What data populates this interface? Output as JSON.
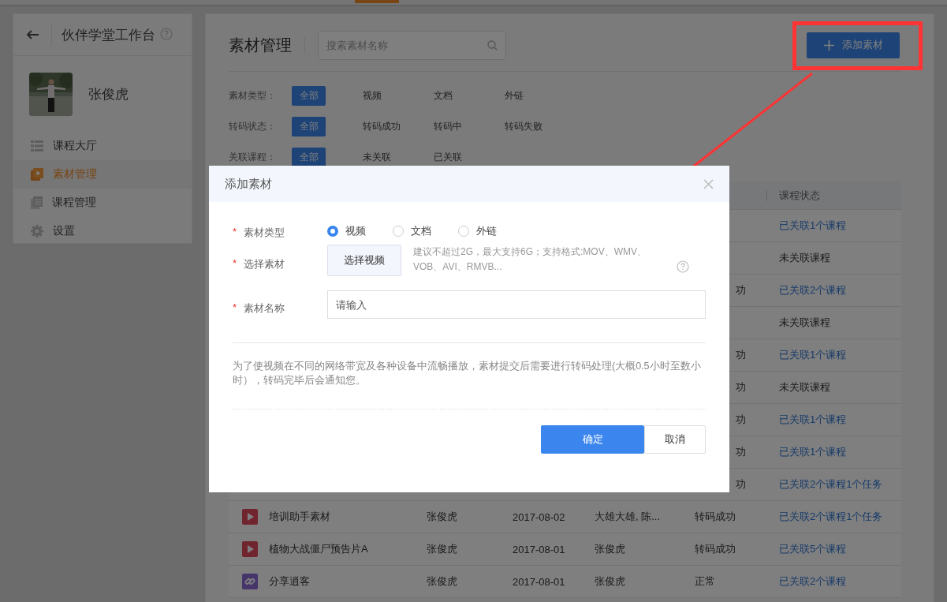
{
  "sidebar": {
    "title": "伙伴学堂工作台",
    "user": {
      "name": "张俊虎"
    },
    "menu": [
      {
        "label": "课程大厅",
        "kind": "list",
        "selected": false
      },
      {
        "label": "素材管理",
        "kind": "media",
        "selected": true
      },
      {
        "label": "课程管理",
        "kind": "doc",
        "selected": false
      },
      {
        "label": "设置",
        "kind": "gear",
        "selected": false
      }
    ]
  },
  "main": {
    "title": "素材管理",
    "search": {
      "placeholder": "搜索素材名称"
    },
    "add_button": "添加素材",
    "filters": [
      {
        "label": "素材类型：",
        "options": [
          {
            "label": "全部",
            "selected": true
          },
          {
            "label": "视频",
            "selected": false
          },
          {
            "label": "文档",
            "selected": false
          },
          {
            "label": "外链",
            "selected": false
          }
        ]
      },
      {
        "label": "转码状态：",
        "options": [
          {
            "label": "全部",
            "selected": true
          },
          {
            "label": "转码成功",
            "selected": false
          },
          {
            "label": "转码中",
            "selected": false
          },
          {
            "label": "转码失败",
            "selected": false
          }
        ]
      },
      {
        "label": "关联课程：",
        "options": [
          {
            "label": "全部",
            "selected": true
          },
          {
            "label": "未关联",
            "selected": false
          },
          {
            "label": "已关联",
            "selected": false
          }
        ]
      }
    ],
    "table": {
      "columns": [
        "课程状态"
      ],
      "rows": [
        {
          "kind": "covered",
          "course_status": "已关联1个课程",
          "linked": true
        },
        {
          "kind": "covered",
          "course_status": "未关联课程",
          "linked": false
        },
        {
          "kind": "covered",
          "transcode": "功",
          "course_status": "已关联2个课程",
          "linked": true
        },
        {
          "kind": "covered",
          "course_status": "未关联课程",
          "linked": false
        },
        {
          "kind": "covered",
          "transcode": "功",
          "course_status": "已关联1个课程",
          "linked": true
        },
        {
          "kind": "covered",
          "transcode": "功",
          "course_status": "未关联课程",
          "linked": false
        },
        {
          "kind": "covered",
          "transcode": "功",
          "course_status": "已关联1个课程",
          "linked": true
        },
        {
          "kind": "covered",
          "transcode": "功",
          "course_status": "已关联1个课程",
          "linked": true
        },
        {
          "kind": "covered",
          "transcode": "功",
          "course_status": "已关联2个课程1个任务",
          "linked": true
        },
        {
          "kind": "video",
          "name": "培训助手素材",
          "owner": "张俊虎",
          "date": "2017-08-02",
          "column_4": "大雄大雄, 陈...",
          "transcode": "转码成功",
          "course_status": "已关联2个课程1个任务",
          "linked": true
        },
        {
          "kind": "video",
          "name": "植物大战僵尸预告片A",
          "owner": "张俊虎",
          "date": "2017-08-01",
          "column_4": "张俊虎",
          "transcode": "转码成功",
          "course_status": "已关联5个课程",
          "linked": true
        },
        {
          "kind": "link",
          "name": "分享逍客",
          "owner": "张俊虎",
          "date": "2017-08-01",
          "column_4": "张俊虎",
          "transcode": "正常",
          "course_status": "已关联2个课程",
          "linked": true
        }
      ]
    }
  },
  "dialog": {
    "title": "添加素材",
    "fields": [
      {
        "kind": "radio",
        "label": "素材类型",
        "required_mark": "*",
        "options": [
          {
            "label": "视频",
            "selected": true
          },
          {
            "label": "文档",
            "selected": false
          },
          {
            "label": "外链",
            "selected": false
          }
        ]
      },
      {
        "kind": "file",
        "label": "选择素材",
        "required_mark": "*",
        "button": "选择视频",
        "hint": "建议不超过2G，最大支持6G；支持格式:MOV、WMV、VOB、AVI、RMVB..."
      },
      {
        "kind": "text",
        "label": "素材名称",
        "required_mark": "*",
        "placeholder": "请输入"
      }
    ],
    "note": "为了使视频在不同的网络带宽及各种设备中流畅播放，素材提交后需要进行转码处理(大概0.5小时至数小时），转码完毕后会通知您。",
    "buttons": [
      {
        "label": "确定",
        "kind": "primary"
      },
      {
        "label": "取消",
        "kind": "default"
      }
    ]
  }
}
